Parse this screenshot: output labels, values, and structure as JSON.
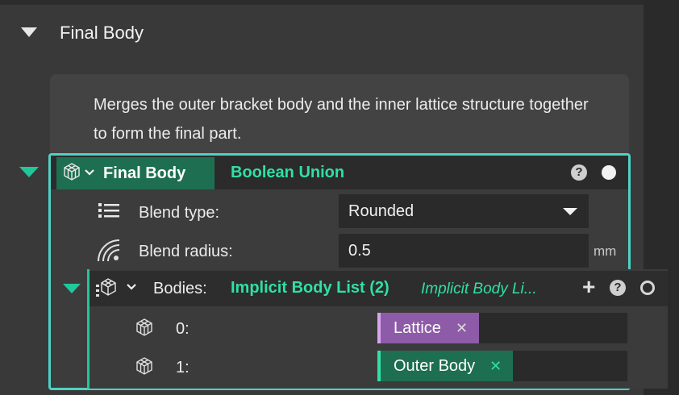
{
  "section": {
    "title": "Final Body",
    "description": "Merges the outer bracket body and the inner lattice structure together to form the final part."
  },
  "node": {
    "name": "Final Body",
    "type": "Boolean Union",
    "help_icon": "question-circle-icon",
    "status_icon": "filled-dot-icon"
  },
  "properties": {
    "blend_type": {
      "label": "Blend type:",
      "value": "Rounded",
      "icon": "list-icon"
    },
    "blend_radius": {
      "label": "Blend radius:",
      "value": "0.5",
      "unit": "mm",
      "icon": "radius-icon"
    }
  },
  "bodies": {
    "label": "Bodies:",
    "type": "Implicit Body List (2)",
    "type_secondary": "Implicit Body Li...",
    "add_icon": "plus-icon",
    "help_icon": "question-circle-icon",
    "status_icon": "outline-dot-icon",
    "items": [
      {
        "index": "0:",
        "value": "Lattice",
        "remove": "✕"
      },
      {
        "index": "1:",
        "value": "Outer Body",
        "remove": "✕"
      }
    ]
  },
  "colors": {
    "accent_teal": "#4fd1c5",
    "accent_green": "#2fe0a6",
    "node_pill": "#1e6f52",
    "lattice_tag": "#8e5ba8"
  }
}
